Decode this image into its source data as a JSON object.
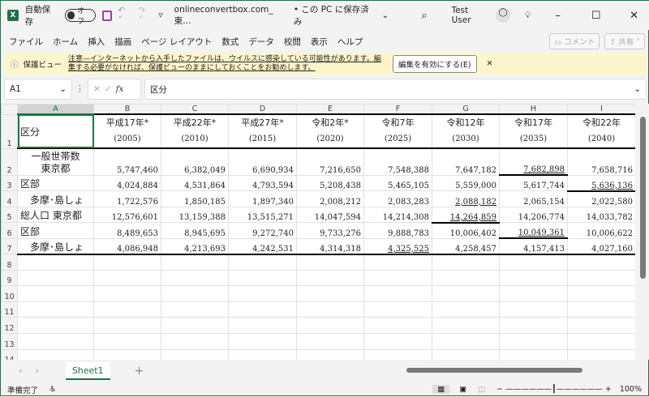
{
  "titlebar": {
    "app_icon": "X",
    "autosave_label": "自動保存",
    "autosave_state": "オフ",
    "filename": "onlineconvertbox.com_東…",
    "save_status": "• この PC に保存済み",
    "user": "Test User"
  },
  "menu": [
    "ファイル",
    "ホーム",
    "挿入",
    "描画",
    "ページ レイアウト",
    "数式",
    "データ",
    "校閲",
    "表示",
    "ヘルプ"
  ],
  "ribbon_buttons": {
    "comment": "コメント",
    "share": "共有"
  },
  "protected_view": {
    "title": "保護ビュー",
    "message": "注意—インターネットから入手したファイルは、ウイルスに感染している可能性があります。編集する必要がなければ、保護ビューのままにしておくことをお勧めします。",
    "enable_button": "編集を有効にする(E)"
  },
  "formula_bar": {
    "name_box": "A1",
    "fx": "fx",
    "content": "区分"
  },
  "columns": [
    "A",
    "B",
    "C",
    "D",
    "E",
    "F",
    "G",
    "H",
    "I"
  ],
  "header_row": {
    "a": "区分",
    "cols": [
      [
        "平成17年*",
        "(2005)"
      ],
      [
        "平成22年*",
        "(2010)"
      ],
      [
        "平成27年*",
        "(2015)"
      ],
      [
        "令和2年*",
        "(2020)"
      ],
      [
        "令和7年",
        "(2025)"
      ],
      [
        "令和12年",
        "(2030)"
      ],
      [
        "令和17年",
        "(2035)"
      ],
      [
        "令和22年",
        "(2040)"
      ]
    ]
  },
  "rows": [
    {
      "n": "2",
      "label": "一般世帯数\n東京都",
      "values": [
        "5,747,460",
        "6,382,049",
        "6,690,934",
        "7,216,650",
        "7,548,388",
        "7,647,182",
        "7,682,898",
        "7,658,716"
      ],
      "u": [
        6
      ]
    },
    {
      "n": "3",
      "label": "区部",
      "values": [
        "4,024,884",
        "4,531,864",
        "4,793,594",
        "5,208,438",
        "5,465,105",
        "5,559,000",
        "5,617,744",
        "5,636,136"
      ],
      "u": [
        7
      ]
    },
    {
      "n": "4",
      "label": "　多摩･島しょ",
      "values": [
        "1,722,576",
        "1,850,185",
        "1,897,340",
        "2,008,212",
        "2,083,283",
        "2,088,182",
        "2,065,154",
        "2,022,580"
      ],
      "u": [
        5
      ]
    },
    {
      "n": "5",
      "label": "総人口  東京都",
      "values": [
        "12,576,601",
        "13,159,388",
        "13,515,271",
        "14,047,594",
        "14,214,308",
        "14,264,859",
        "14,206,774",
        "14,033,782"
      ],
      "u": [
        5
      ]
    },
    {
      "n": "6",
      "label": "区部",
      "values": [
        "8,489,653",
        "8,945,695",
        "9,272,740",
        "9,733,276",
        "9,888,783",
        "10,006,402",
        "10,049,361",
        "10,006,622"
      ],
      "u": [
        6
      ]
    },
    {
      "n": "7",
      "label": "　多摩･島しょ",
      "values": [
        "4,086,948",
        "4,213,693",
        "4,242,531",
        "4,314,318",
        "4,325,525",
        "4,258,457",
        "4,157,413",
        "4,027,160"
      ],
      "u": [
        4
      ]
    }
  ],
  "empty_rows": [
    "8",
    "9",
    "10",
    "11",
    "12",
    "13",
    "14"
  ],
  "sheet_tab": "Sheet1",
  "status": {
    "ready": "準備完了",
    "zoom": "100%"
  }
}
